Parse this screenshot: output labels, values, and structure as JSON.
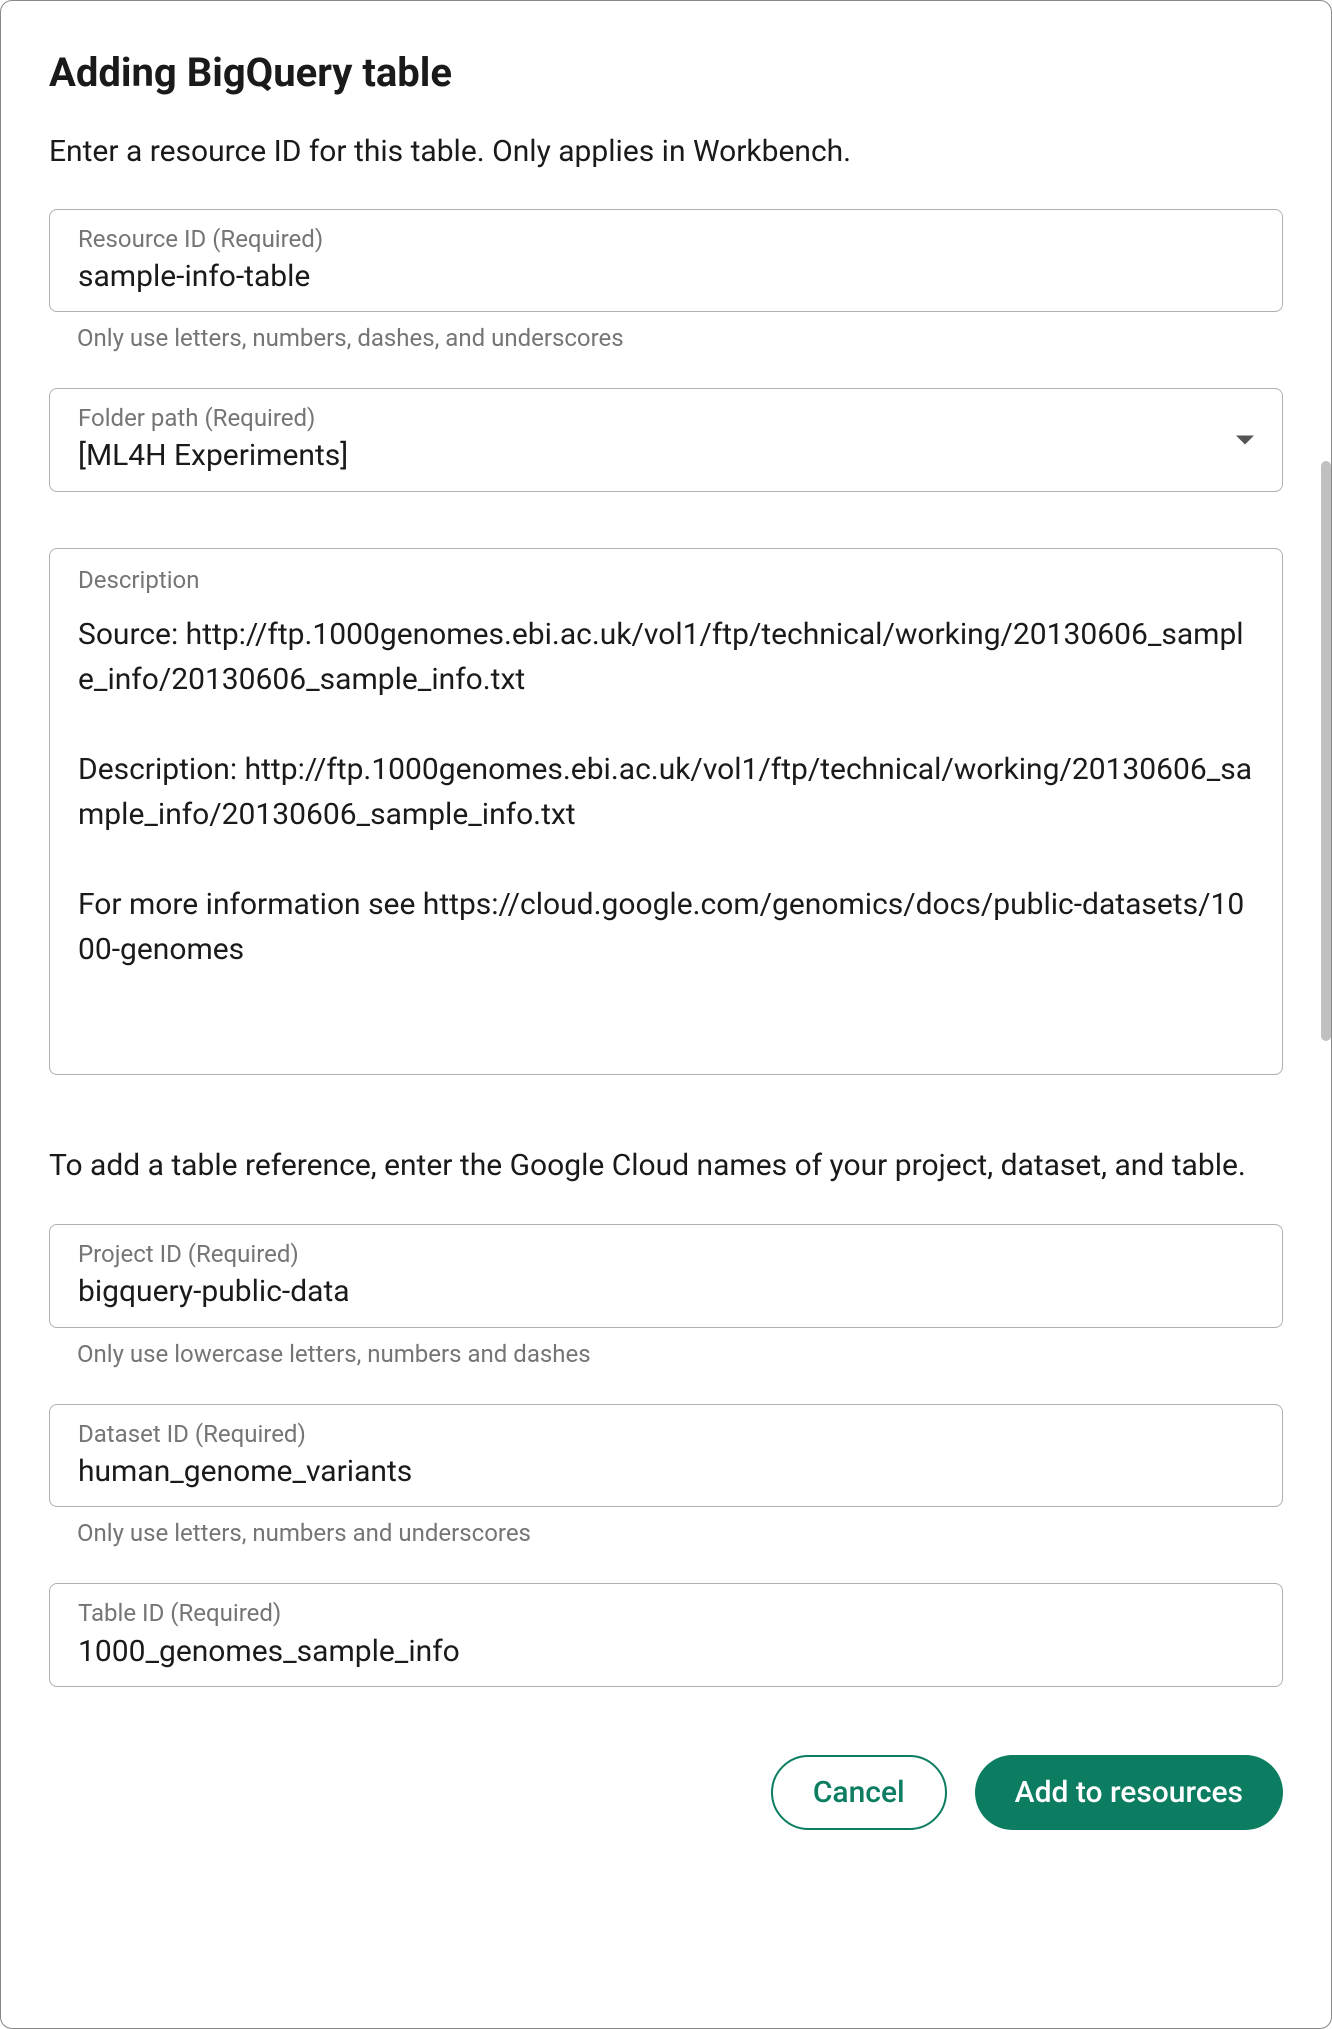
{
  "dialog": {
    "title": "Adding BigQuery table",
    "subtitle": "Enter a resource ID for this table. Only applies in Workbench."
  },
  "fields": {
    "resource_id": {
      "label": "Resource ID (Required)",
      "value": "sample-info-table",
      "helper": "Only use letters, numbers, dashes, and underscores"
    },
    "folder_path": {
      "label": "Folder path (Required)",
      "value": "[ML4H Experiments]"
    },
    "description": {
      "label": "Description",
      "value": "Source: http://ftp.1000genomes.ebi.ac.uk/vol1/ftp/technical/working/20130606_sample_info/20130606_sample_info.txt\n\nDescription: http://ftp.1000genomes.ebi.ac.uk/vol1/ftp/technical/working/20130606_sample_info/20130606_sample_info.txt\n\nFor more information see https://cloud.google.com/genomics/docs/public-datasets/1000-genomes"
    },
    "project_id": {
      "label": "Project ID (Required)",
      "value": "bigquery-public-data",
      "helper": "Only use lowercase letters, numbers and dashes"
    },
    "dataset_id": {
      "label": "Dataset ID (Required)",
      "value": "human_genome_variants",
      "helper": "Only use letters, numbers and underscores"
    },
    "table_id": {
      "label": "Table ID (Required)",
      "value": "1000_genomes_sample_info"
    }
  },
  "section_note": "To add a table reference, enter the Google Cloud names of your project, dataset, and table.",
  "buttons": {
    "cancel": "Cancel",
    "add": "Add to resources"
  }
}
